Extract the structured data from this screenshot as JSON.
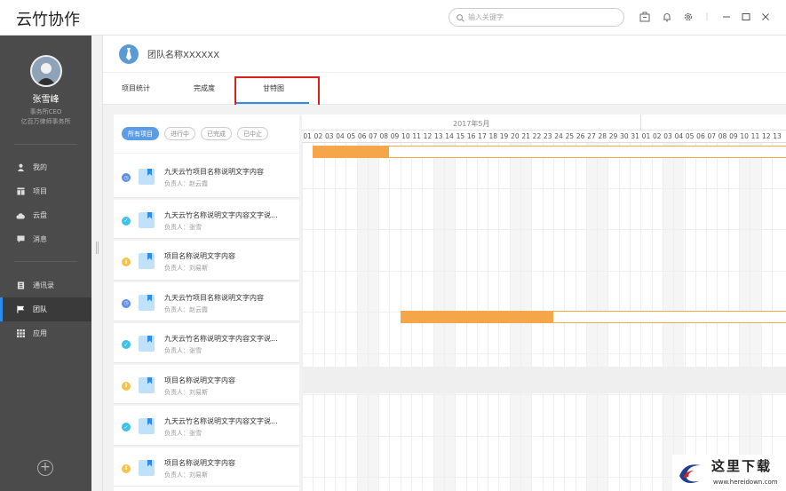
{
  "app": {
    "title": "云竹协作"
  },
  "search": {
    "placeholder": "输入关键字"
  },
  "user": {
    "name": "张雪峰",
    "line1": "事务所CEO",
    "line2": "亿百万律师事务所"
  },
  "nav": [
    {
      "label": "我的",
      "icon": "person-icon"
    },
    {
      "label": "项目",
      "icon": "project-icon"
    },
    {
      "label": "云盘",
      "icon": "cloud-icon"
    },
    {
      "label": "消息",
      "icon": "message-icon"
    },
    {
      "label": "通讯录",
      "icon": "contacts-icon"
    },
    {
      "label": "团队",
      "icon": "flag-icon",
      "active": true
    },
    {
      "label": "应用",
      "icon": "grid-icon"
    }
  ],
  "team": {
    "name": "团队名称XXXXXX"
  },
  "tabs": [
    {
      "label": "项目统计"
    },
    {
      "label": "完成度"
    },
    {
      "label": "甘特图",
      "active": true
    }
  ],
  "filters": [
    {
      "label": "所有项目",
      "active": true
    },
    {
      "label": "进行中"
    },
    {
      "label": "已完成"
    },
    {
      "label": "已中止"
    }
  ],
  "projects": [
    {
      "title": "九天云竹项目名称说明文字内容",
      "owner": "负责人：赵云霞",
      "status": "in-progress",
      "color": "#5b8def"
    },
    {
      "title": "九天云竹名称说明文字内容文字说...",
      "owner": "负责人：张雪",
      "status": "done",
      "color": "#3cc2ea"
    },
    {
      "title": "项目名称说明文字内容",
      "owner": "负责人：刘易斯",
      "status": "paused",
      "color": "#f4c34a"
    },
    {
      "title": "九天云竹项目名称说明文字内容",
      "owner": "负责人：赵云霞",
      "status": "in-progress",
      "color": "#5b8def"
    },
    {
      "title": "九天云竹名称说明文字内容文字说...",
      "owner": "负责人：张雪",
      "status": "done",
      "color": "#3cc2ea"
    },
    {
      "title": "项目名称说明文字内容",
      "owner": "负责人：刘易斯",
      "status": "paused",
      "color": "#f4c34a"
    },
    {
      "title": "九天云竹名称说明文字内容文字说...",
      "owner": "负责人：张雪",
      "status": "done",
      "color": "#3cc2ea"
    },
    {
      "title": "项目名称说明文字内容",
      "owner": "负责人：刘易斯",
      "status": "paused",
      "color": "#f4c34a"
    }
  ],
  "gantt": {
    "month": "2017年5月",
    "days": [
      "01",
      "02",
      "03",
      "04",
      "05",
      "06",
      "07",
      "08",
      "09",
      "10",
      "11",
      "12",
      "13",
      "14",
      "15",
      "16",
      "17",
      "18",
      "19",
      "20",
      "21",
      "22",
      "23",
      "24",
      "25",
      "26",
      "27",
      "28",
      "29",
      "30",
      "31",
      "01",
      "02",
      "03",
      "04",
      "05",
      "06",
      "07",
      "08",
      "09",
      "10",
      "11",
      "12",
      "13"
    ],
    "bars": [
      {
        "row": 0,
        "start": "2017-05-02",
        "fill_end": "2017-05-09"
      },
      {
        "row": 4,
        "start": "2017-05-10",
        "fill_end": "2017-05-24"
      }
    ],
    "bar_color": "#f5a54a"
  },
  "watermark": {
    "text": "这里下载",
    "url": "www.hereidown.com"
  }
}
